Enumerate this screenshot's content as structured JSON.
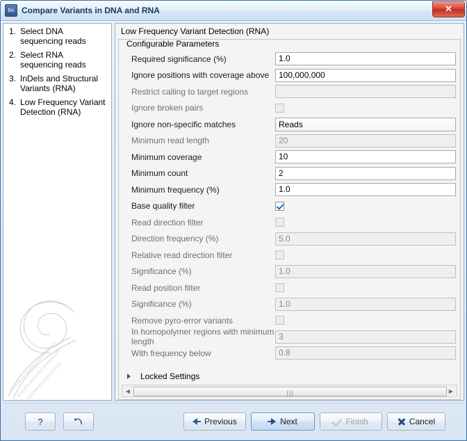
{
  "window": {
    "title": "Compare Variants in DNA and RNA",
    "app_icon": "bx",
    "close_label": "✕"
  },
  "sidebar": {
    "steps": [
      {
        "num": "1.",
        "label": "Select DNA sequencing reads"
      },
      {
        "num": "2.",
        "label": "Select RNA sequencing reads"
      },
      {
        "num": "3.",
        "label": "InDels and Structural Variants (RNA)"
      },
      {
        "num": "4.",
        "label": "Low Frequency Variant Detection (RNA)"
      }
    ]
  },
  "panel": {
    "title": "Low Frequency Variant Detection (RNA)",
    "group_title": "Configurable Parameters",
    "rows": [
      {
        "label": "Required significance (%)",
        "type": "text",
        "value": "1.0",
        "enabled": true
      },
      {
        "label": "Ignore positions with coverage above",
        "type": "text",
        "value": "100,000,000",
        "enabled": true
      },
      {
        "label": "Restrict calling to target regions",
        "type": "text",
        "value": "",
        "enabled": false
      },
      {
        "label": "Ignore broken pairs",
        "type": "checkbox",
        "checked": false,
        "enabled": false
      },
      {
        "label": "Ignore non-specific matches",
        "type": "combo",
        "value": "Reads",
        "enabled": true
      },
      {
        "label": "Minimum read length",
        "type": "text",
        "value": "20",
        "enabled": false
      },
      {
        "label": "Minimum coverage",
        "type": "text",
        "value": "10",
        "enabled": true
      },
      {
        "label": "Minimum count",
        "type": "text",
        "value": "2",
        "enabled": true
      },
      {
        "label": "Minimum frequency (%)",
        "type": "text",
        "value": "1.0",
        "enabled": true
      },
      {
        "label": "Base quality filter",
        "type": "checkbox",
        "checked": true,
        "enabled": true
      },
      {
        "label": "Read direction filter",
        "type": "checkbox",
        "checked": false,
        "enabled": false
      },
      {
        "label": "Direction frequency (%)",
        "type": "text",
        "value": "5.0",
        "enabled": false
      },
      {
        "label": "Relative read direction filter",
        "type": "checkbox",
        "checked": false,
        "enabled": false
      },
      {
        "label": "Significance (%)",
        "type": "text",
        "value": "1.0",
        "enabled": false
      },
      {
        "label": "Read position filter",
        "type": "checkbox",
        "checked": false,
        "enabled": false
      },
      {
        "label": "Significance (%)",
        "type": "text",
        "value": "1.0",
        "enabled": false
      },
      {
        "label": "Remove pyro-error variants",
        "type": "checkbox",
        "checked": false,
        "enabled": false
      },
      {
        "label": "In homopolymer regions with minimum length",
        "type": "text",
        "value": "3",
        "enabled": false
      },
      {
        "label": "With frequency below",
        "type": "text",
        "value": "0.8",
        "enabled": false
      }
    ],
    "locked_settings_label": "Locked Settings",
    "scrollbar": {
      "left_arrow": "◀",
      "right_arrow": "▶",
      "grip": "|||"
    }
  },
  "footer": {
    "help_label": "?",
    "reset_label": "",
    "previous_label": "Previous",
    "next_label": "Next",
    "finish_label": "Finish",
    "cancel_label": "Cancel"
  }
}
